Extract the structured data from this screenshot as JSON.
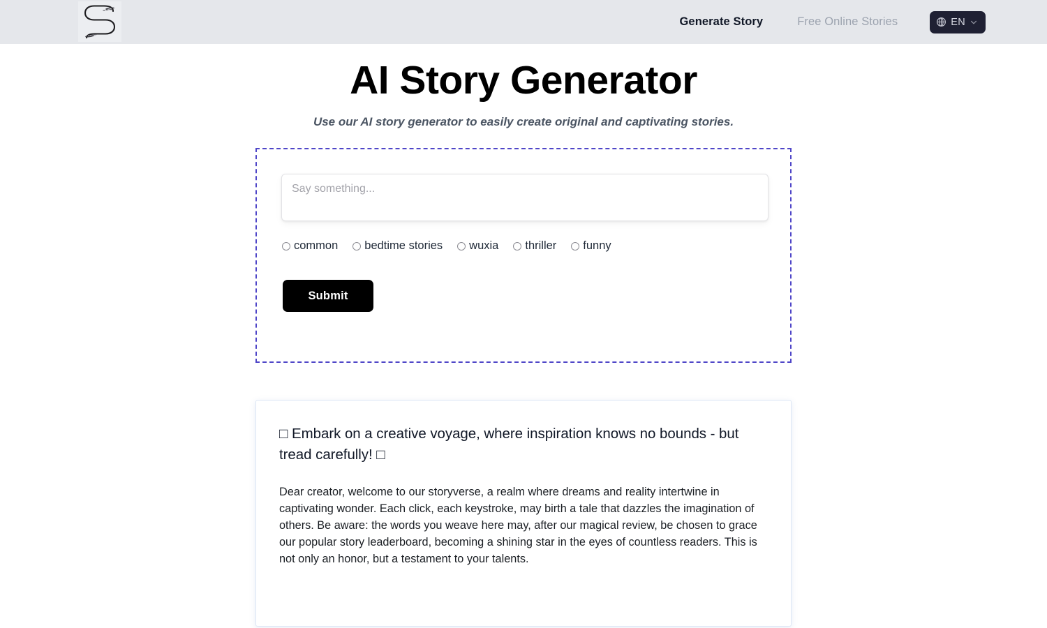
{
  "header": {
    "logo_icon": "stylized-s-logo",
    "nav": [
      {
        "label": "Generate Story",
        "state": "active"
      },
      {
        "label": "Free Online Stories",
        "state": "muted"
      }
    ],
    "language_button": {
      "icon": "globe-icon",
      "label": "EN",
      "caret_icon": "chevron-down-icon"
    },
    "background_color": "#e5e7eb"
  },
  "hero": {
    "title": "AI Story Generator",
    "subtitle": "Use our AI story generator to easily create original and captivating stories."
  },
  "form": {
    "border_color": "#4f46c8",
    "prompt_input": {
      "value": "",
      "placeholder": "Say something..."
    },
    "genres": [
      {
        "label": "common",
        "checked": false
      },
      {
        "label": "bedtime stories",
        "checked": false
      },
      {
        "label": "wuxia",
        "checked": false
      },
      {
        "label": "thriller",
        "checked": false
      },
      {
        "label": "funny",
        "checked": false
      }
    ],
    "submit_label": "Submit"
  },
  "notice": {
    "title": "□ Embark on a creative voyage, where inspiration knows no bounds - but tread carefully! □",
    "body": "Dear creator, welcome to our storyverse, a realm where dreams and reality intertwine in captivating wonder. Each click, each keystroke, may birth a tale that dazzles the imagination of others. Be aware: the words you weave here may, after our magical review, be chosen to grace our popular story leaderboard, becoming a shining star in the eyes of countless readers. This is not only an honor, but a testament to your talents.",
    "border_color": "#dde6f5"
  }
}
